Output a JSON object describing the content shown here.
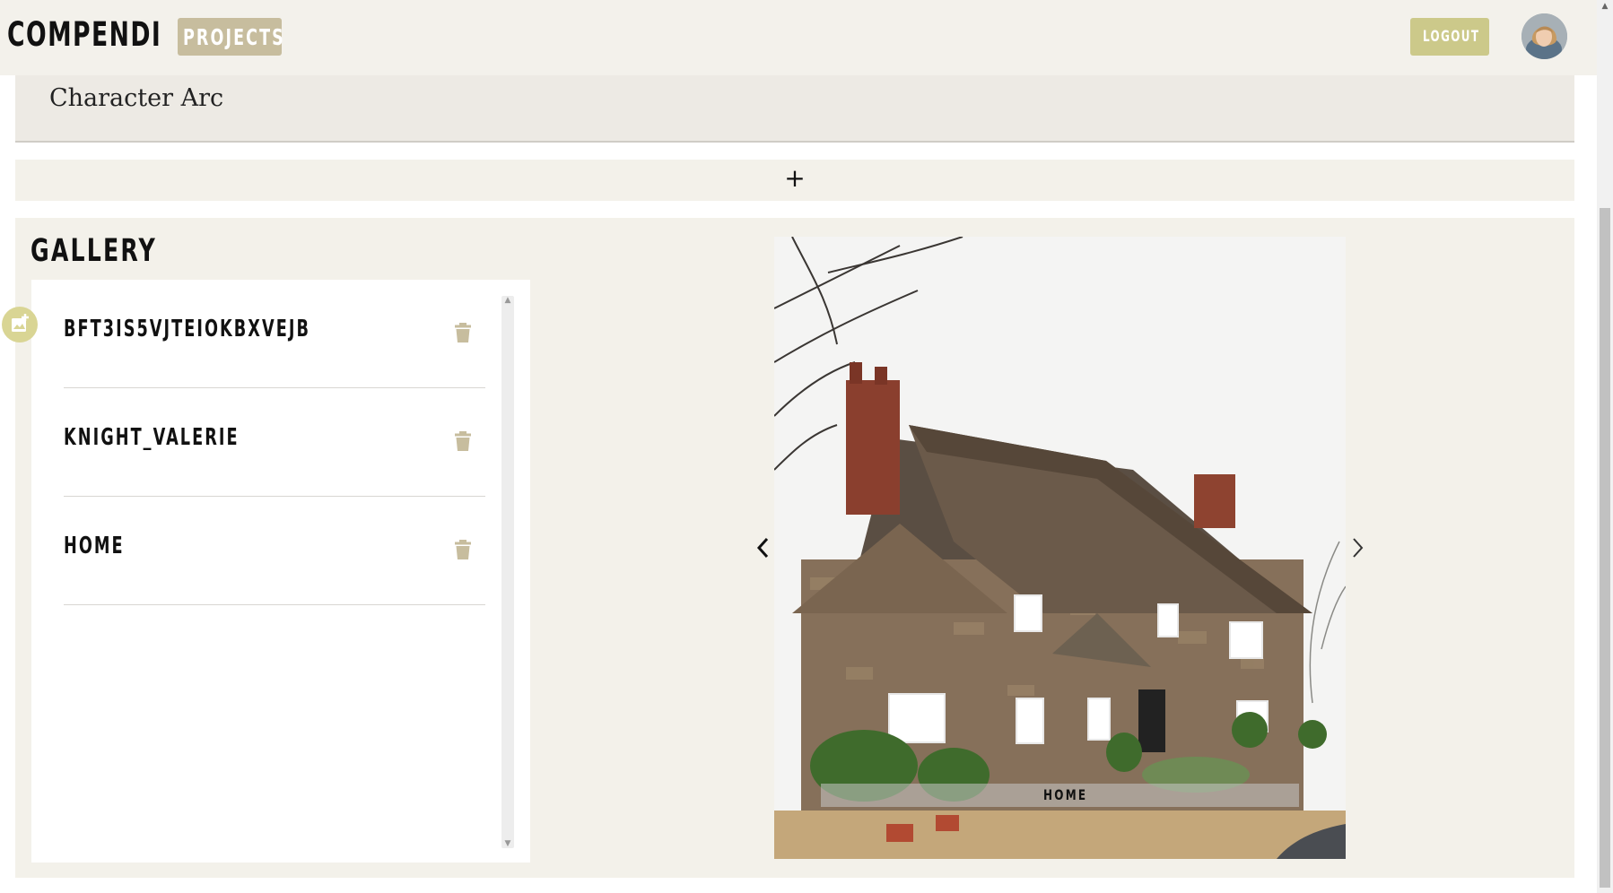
{
  "header": {
    "logo": "COMPENDI",
    "projects_label": "PROJECTS",
    "logout_label": "LOGOUT"
  },
  "arc_panel": {
    "title": "Character Arc"
  },
  "add_row": {
    "label": "+"
  },
  "gallery": {
    "title": "GALLERY",
    "items": [
      {
        "name": "BFT3IS5VJTEIOKBXVEJB"
      },
      {
        "name": "KNIGHT_VALERIE"
      },
      {
        "name": "HOME"
      }
    ],
    "carousel_caption": "HOME"
  },
  "colors": {
    "header_bg": "#f3f1eb",
    "projects_btn": "#c7bd9e",
    "logout_btn": "#ccc98a",
    "trash_icon": "#c7bd9e",
    "panel_bg": "#f3f1ea"
  }
}
